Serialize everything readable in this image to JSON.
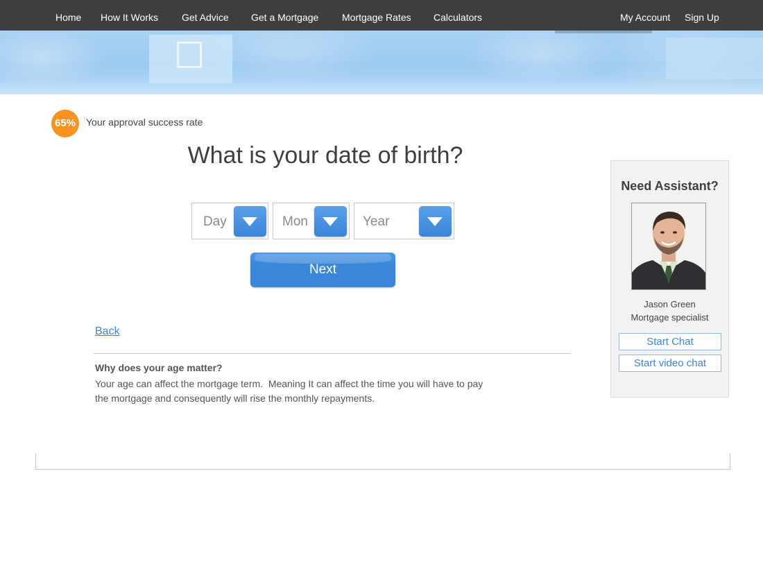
{
  "nav": {
    "left": [
      "Home",
      "How It Works",
      "Get Advice",
      "Get a Mortgage",
      "Mortgage Rates",
      "Calculators"
    ],
    "my_account": "My Account",
    "sign_up": "Sign Up"
  },
  "approval": {
    "rate": "65%",
    "label": "Your approval success rate"
  },
  "question": "What is your date of birth?",
  "dob": {
    "day": "Day",
    "month": "Mon",
    "year": "Year"
  },
  "next_label": "Next",
  "back_label": "Back",
  "why": {
    "title": "Why does your age matter?",
    "line1": "Your age can affect the mortgage term.  Meaning It can affect the time you will have to pay",
    "line2": "the mortgage and consequently will rise the monthly repayments."
  },
  "assistant": {
    "title": "Need Assistant?",
    "name": "Jason Green",
    "role": "Mortgage specialist",
    "chat_label": "Start Chat",
    "video_label": "Start video chat"
  },
  "colors": {
    "nav_bg": "#3d3e40",
    "accent_blue": "#3a86da",
    "badge_orange": "#f7931e"
  }
}
